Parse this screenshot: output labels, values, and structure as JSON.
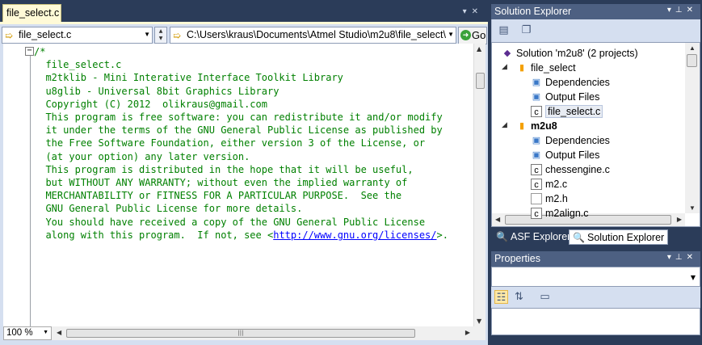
{
  "editor": {
    "tab_title": "file_select.c",
    "nav": {
      "file_combo": "file_select.c",
      "path_combo": "C:\\Users\\kraus\\Documents\\Atmel Studio\\m2u8\\file_select\\",
      "go_label": "Go"
    },
    "zoom": "100 %",
    "code_lines": [
      "/*",
      "",
      "  file_select.c",
      "",
      "  m2tklib - Mini Interative Interface Toolkit Library",
      "  u8glib - Universal 8bit Graphics Library",
      "",
      "  Copyright (C) 2012  olikraus@gmail.com",
      "",
      "  This program is free software: you can redistribute it and/or modify",
      "  it under the terms of the GNU General Public License as published by",
      "  the Free Software Foundation, either version 3 of the License, or",
      "  (at your option) any later version.",
      "",
      "  This program is distributed in the hope that it will be useful,",
      "  but WITHOUT ANY WARRANTY; without even the implied warranty of",
      "  MERCHANTABILITY or FITNESS FOR A PARTICULAR PURPOSE.  See the",
      "  GNU General Public License for more details.",
      "",
      "  You should have received a copy of the GNU General Public License"
    ],
    "last_line_prefix": "  along with this program.  If not, see <",
    "last_line_link": "http://www.gnu.org/licenses/",
    "last_line_suffix": ">."
  },
  "solution_explorer": {
    "title": "Solution Explorer",
    "tree": [
      {
        "label": "Solution 'm2u8' (2 projects)",
        "icon": "solution-icon",
        "level": 0,
        "expander": ""
      },
      {
        "label": "file_select",
        "icon": "project-icon",
        "level": 1,
        "expander": "◢",
        "bold": false
      },
      {
        "label": "Dependencies",
        "icon": "folder-icon",
        "level": 2,
        "expander": ""
      },
      {
        "label": "Output Files",
        "icon": "folder-icon",
        "level": 2,
        "expander": ""
      },
      {
        "label": "file_select.c",
        "icon": "c-file-icon",
        "level": 2,
        "expander": "",
        "selected": true
      },
      {
        "label": "m2u8",
        "icon": "project-icon",
        "level": 1,
        "expander": "◢",
        "bold": true
      },
      {
        "label": "Dependencies",
        "icon": "folder-icon",
        "level": 2,
        "expander": ""
      },
      {
        "label": "Output Files",
        "icon": "folder-icon",
        "level": 2,
        "expander": ""
      },
      {
        "label": "chessengine.c",
        "icon": "c-file-icon",
        "level": 2,
        "expander": ""
      },
      {
        "label": "m2.c",
        "icon": "c-file-icon",
        "level": 2,
        "expander": ""
      },
      {
        "label": "m2.h",
        "icon": "h-file-icon",
        "level": 2,
        "expander": ""
      },
      {
        "label": "m2align.c",
        "icon": "c-file-icon",
        "level": 2,
        "expander": ""
      }
    ],
    "tabs": {
      "asf": "ASF Explorer",
      "solution": "Solution Explorer"
    }
  },
  "properties": {
    "title": "Properties"
  },
  "colors": {
    "frame": "#2b3c59",
    "panel_title": "#4d6082",
    "code_comment": "#008000",
    "link": "#0000ff"
  }
}
